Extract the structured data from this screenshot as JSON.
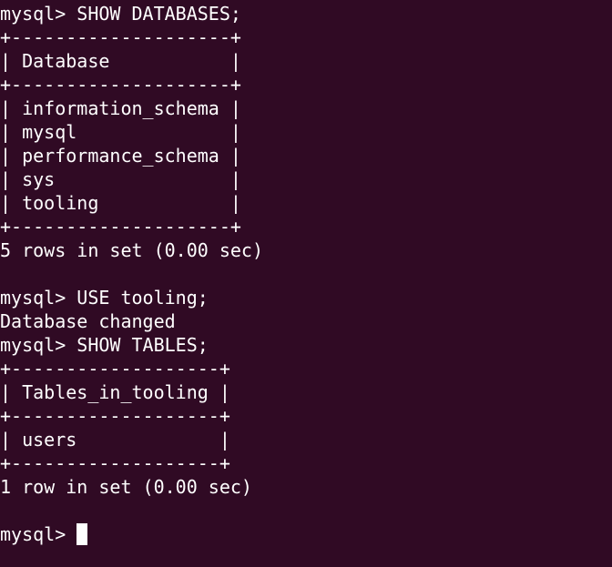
{
  "colors": {
    "background": "#300a24",
    "foreground": "#ffffff"
  },
  "terminal": {
    "lines": [
      "mysql> SHOW DATABASES;",
      "+--------------------+",
      "| Database           |",
      "+--------------------+",
      "| information_schema |",
      "| mysql              |",
      "| performance_schema |",
      "| sys                |",
      "| tooling            |",
      "+--------------------+",
      "5 rows in set (0.00 sec)",
      "",
      "mysql> USE tooling;",
      "Database changed",
      "mysql> SHOW TABLES;",
      "+-------------------+",
      "| Tables_in_tooling |",
      "+-------------------+",
      "| users             |",
      "+-------------------+",
      "1 row in set (0.00 sec)",
      "",
      "mysql> "
    ]
  }
}
